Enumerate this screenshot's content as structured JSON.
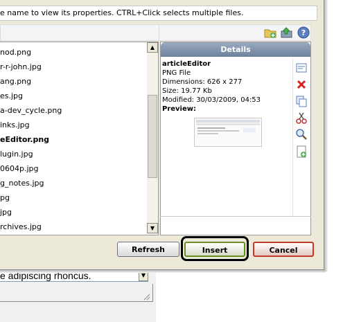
{
  "instruction": "e name to view its properties. CTRL+Click selects multiple files.",
  "files": [
    {
      "name": "nod.png",
      "selected": false
    },
    {
      "name": "r-r-john.jpg",
      "selected": false
    },
    {
      "name": "ang.png",
      "selected": false
    },
    {
      "name": "es.jpg",
      "selected": false
    },
    {
      "name": "a-dev_cycle.png",
      "selected": false
    },
    {
      "name": "inks.jpg",
      "selected": false
    },
    {
      "name": "eEditor.png",
      "selected": true
    },
    {
      "name": "lugin.jpg",
      "selected": false
    },
    {
      "name": "0604p.jpg",
      "selected": false
    },
    {
      "name": "g_notes.jpg",
      "selected": false
    },
    {
      "name": "pg",
      "selected": false
    },
    {
      "name": "jpg",
      "selected": false
    },
    {
      "name": "rchives.jpg",
      "selected": false
    }
  ],
  "details": {
    "header": "Details",
    "name": "articleEditor",
    "type": "PNG File",
    "dimensions": "Dimensions: 626 x 277",
    "size": "Size: 19.77 Kb",
    "modified": "Modified: 30/03/2009, 04:53",
    "preview_label": "Preview:"
  },
  "buttons": {
    "refresh": "Refresh",
    "insert": "Insert",
    "cancel": "Cancel"
  },
  "underlying": {
    "input_text": "e adipiscing rhoncus."
  },
  "icons": {
    "toolbar": [
      "new-folder-icon",
      "upload-icon",
      "help-icon"
    ],
    "side": [
      "insert-into-editor-icon",
      "delete-icon",
      "copy-icon",
      "cut-icon",
      "zoom-icon",
      "paste-icon"
    ]
  }
}
